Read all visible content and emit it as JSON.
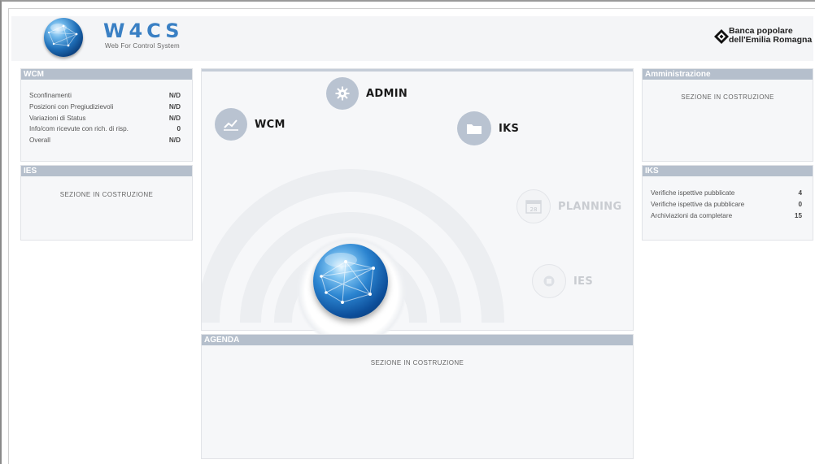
{
  "header": {
    "title": "W4CS",
    "subtitle": "Web For Control System",
    "bank_name_line1": "Banca popolare",
    "bank_name_line2": "dell'Emilia Romagna"
  },
  "wcm_panel": {
    "title": "WCM",
    "rows": [
      {
        "label": "Sconfinamenti",
        "value": "N/D"
      },
      {
        "label": "Posizioni con Pregiudizievoli",
        "value": "N/D"
      },
      {
        "label": "Variazioni di Status",
        "value": "N/D"
      },
      {
        "label": "Info/com ricevute con rich. di risp.",
        "value": "0"
      },
      {
        "label": "Overall",
        "value": "N/D"
      }
    ]
  },
  "ies_panel": {
    "title": "IES",
    "message": "SEZIONE IN COSTRUZIONE"
  },
  "admin_panel": {
    "title": "Amministrazione",
    "message": "SEZIONE IN COSTRUZIONE"
  },
  "iks_panel": {
    "title": "IKS",
    "rows": [
      {
        "label": "Verifiche ispettive pubblicate",
        "value": "4"
      },
      {
        "label": "Verifiche ispettive da pubblicare",
        "value": "0"
      },
      {
        "label": "Archiviazioni da completare",
        "value": "15"
      }
    ]
  },
  "nav": {
    "wcm": "WCM",
    "admin": "ADMIN",
    "iks": "IKS",
    "planning": "PLANNING",
    "planning_icon_day": "28",
    "ies": "IES"
  },
  "agenda_panel": {
    "title": "AGENDA",
    "message": "SEZIONE IN COSTRUZIONE"
  },
  "colors": {
    "panel_header": "#b5bfcc",
    "title_blue": "#3a80c4",
    "nav_circle": "#b9c3d1"
  },
  "icons": {
    "wcm": "chart-line-icon",
    "admin": "gear-icon",
    "iks": "folder-icon",
    "planning": "calendar-icon",
    "ies": "document-icon"
  }
}
